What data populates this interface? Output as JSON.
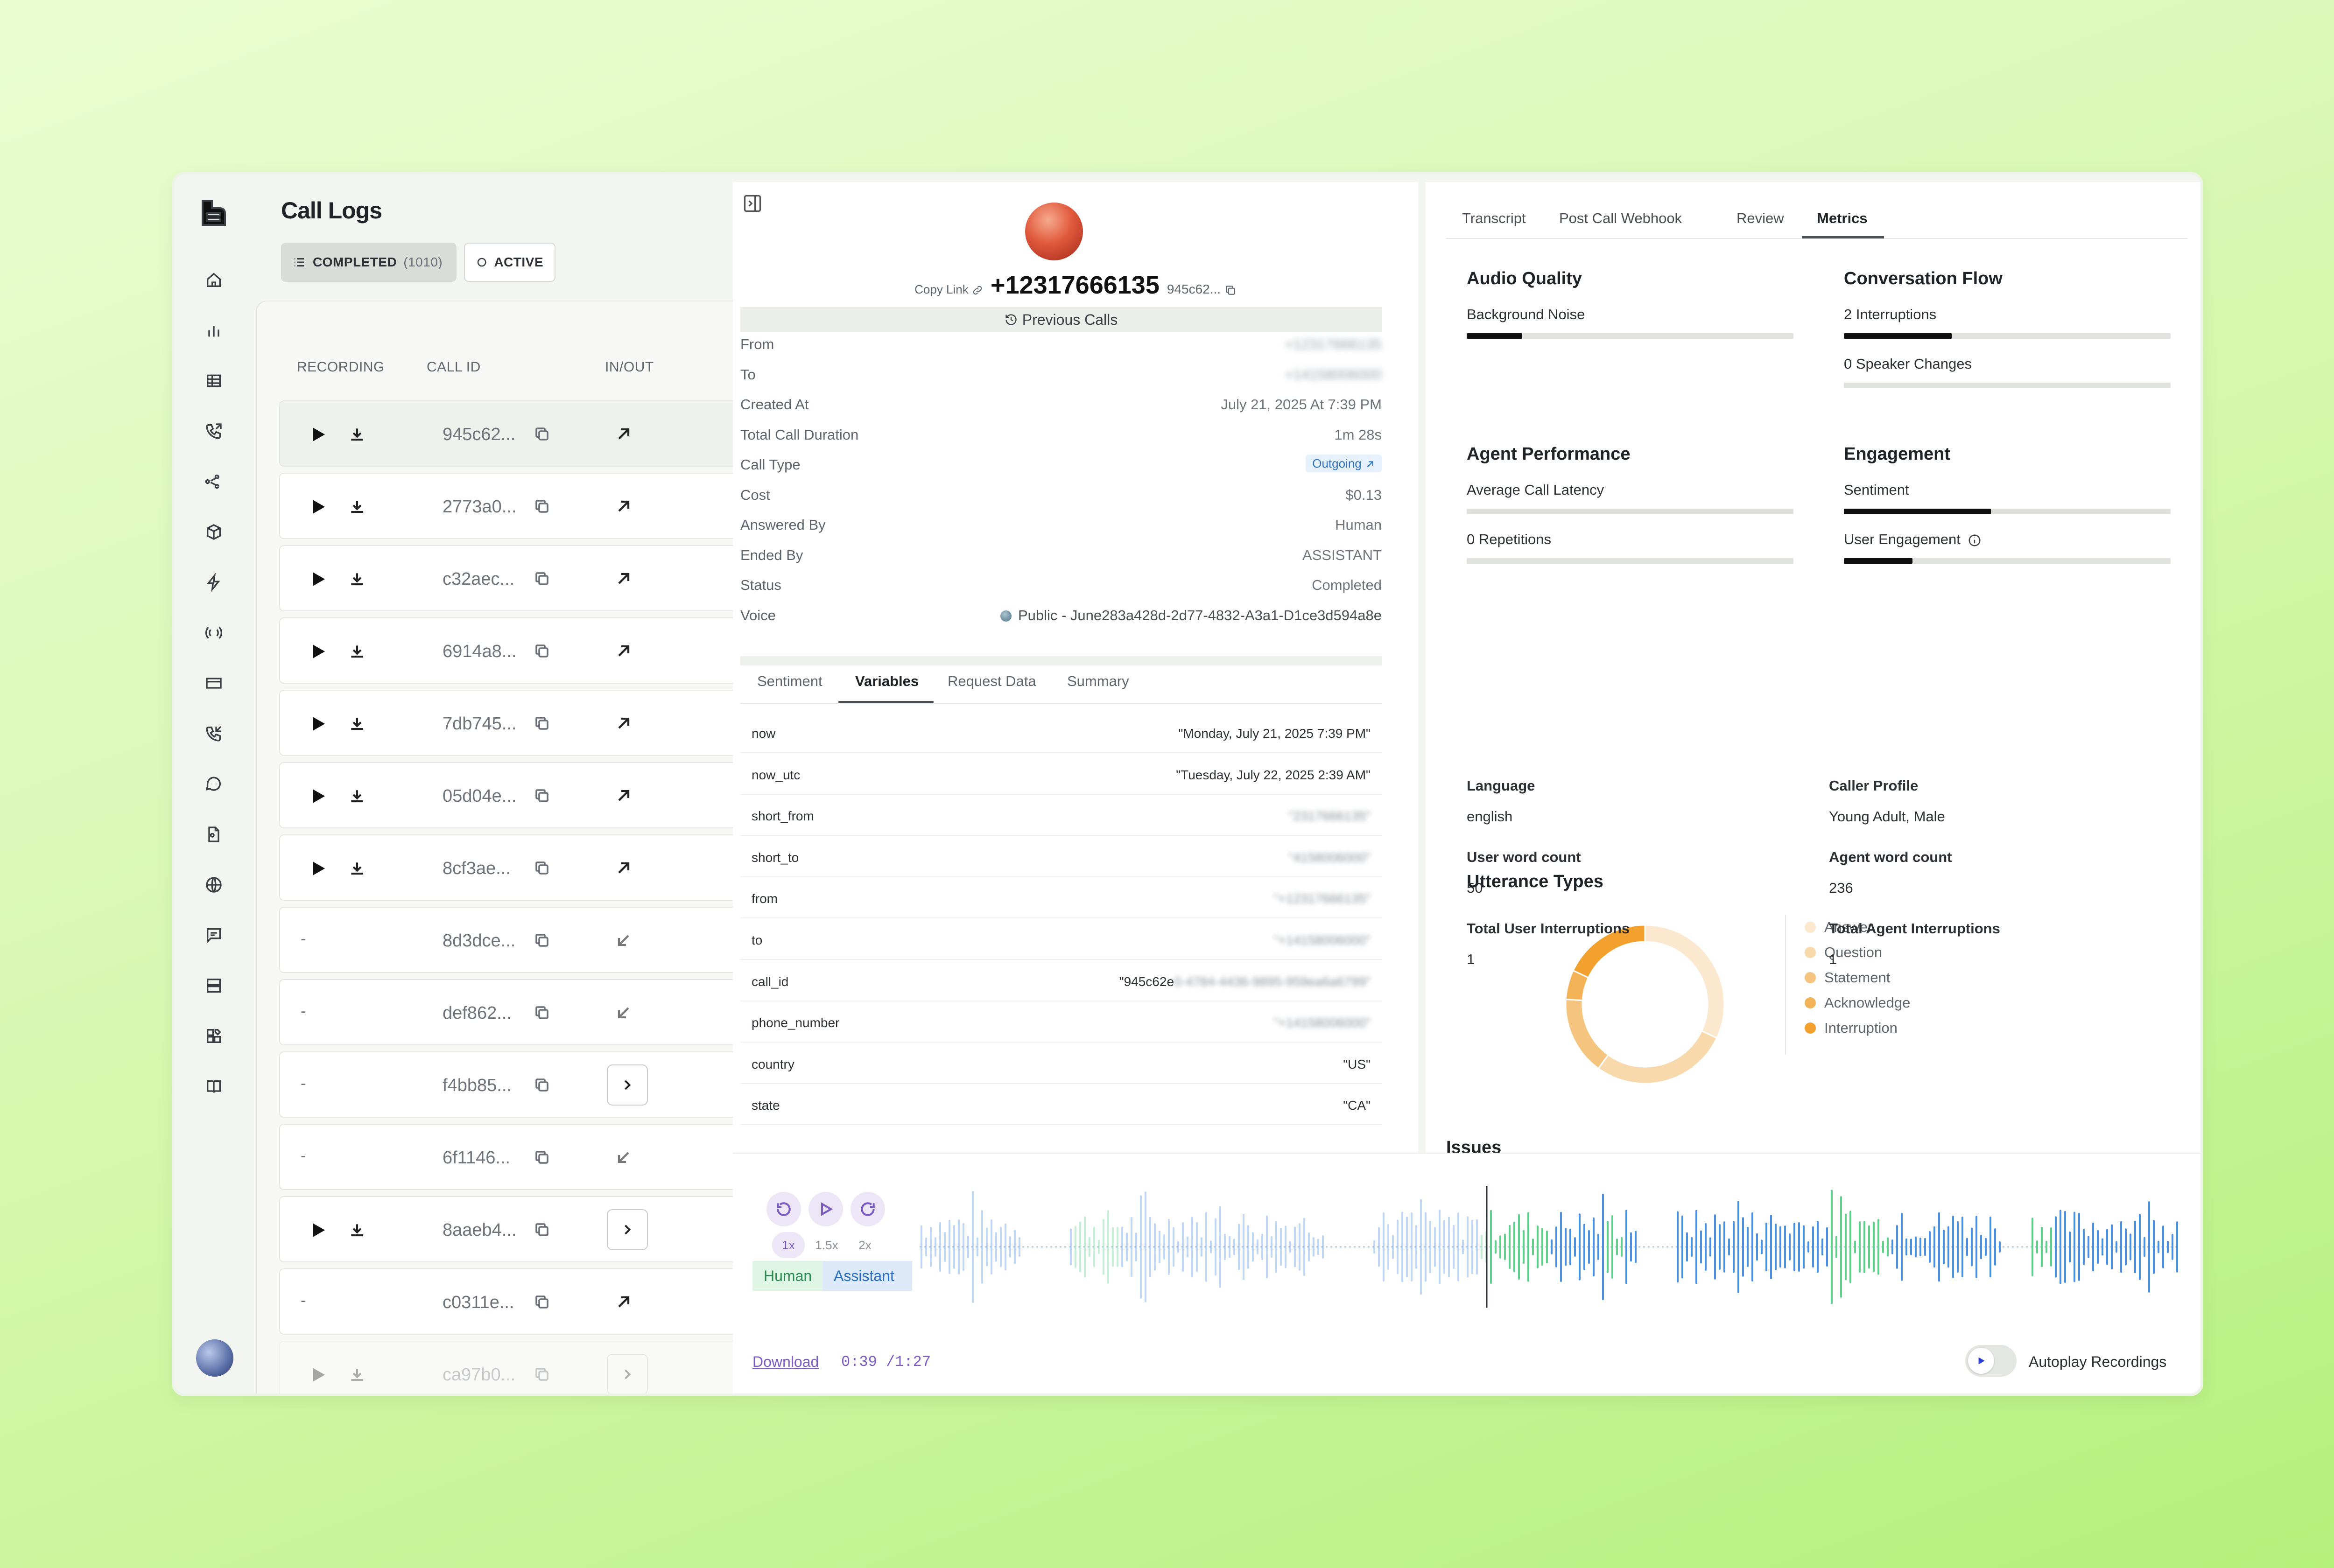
{
  "sidebar": {
    "icons": [
      "home-icon",
      "chart-icon",
      "table-icon",
      "phone-forward-icon",
      "share-icon",
      "box-icon",
      "bolt-icon",
      "broadcast-icon",
      "card-icon",
      "phone-incoming-icon",
      "chat-icon",
      "file-settings-icon",
      "globe-icon",
      "message-square-icon",
      "server-icon",
      "widgets-icon",
      "book-icon"
    ]
  },
  "call_logs": {
    "title": "Call Logs",
    "tab_completed": "COMPLETED",
    "tab_completed_count": "(1010)",
    "tab_active": "ACTIVE",
    "col_recording": "RECORDING",
    "col_call_id": "CALL ID",
    "col_inout": "IN/OUT",
    "rows": [
      {
        "id": "945c62...",
        "recording": true,
        "dir": "out"
      },
      {
        "id": "2773a0...",
        "recording": true,
        "dir": "out"
      },
      {
        "id": "c32aec...",
        "recording": true,
        "dir": "out"
      },
      {
        "id": "6914a8...",
        "recording": true,
        "dir": "out"
      },
      {
        "id": "7db745...",
        "recording": true,
        "dir": "out"
      },
      {
        "id": "05d04e...",
        "recording": true,
        "dir": "out"
      },
      {
        "id": "8cf3ae...",
        "recording": true,
        "dir": "out"
      },
      {
        "id": "8d3dce...",
        "recording": false,
        "dir": "in"
      },
      {
        "id": "def862...",
        "recording": false,
        "dir": "in"
      },
      {
        "id": "f4bb85...",
        "recording": false,
        "dir": "chevron"
      },
      {
        "id": "6f1146...",
        "recording": false,
        "dir": "in"
      },
      {
        "id": "8aaeb4...",
        "recording": true,
        "dir": "chevron"
      },
      {
        "id": "c0311e...",
        "recording": false,
        "dir": "out"
      },
      {
        "id": "ca97b0...",
        "recording": true,
        "dir": "chevron"
      }
    ],
    "dash": "-"
  },
  "details": {
    "copy_link": "Copy Link",
    "phone": "+12317666135",
    "short_id": "945c62...",
    "previous_calls": "Previous Calls",
    "fields": [
      {
        "key": "From",
        "value": "+12317666135",
        "blur": true
      },
      {
        "key": "To",
        "value": "+14158006000",
        "blur": true
      },
      {
        "key": "Created At",
        "value": "July 21, 2025 At 7:39 PM"
      },
      {
        "key": "Total Call Duration",
        "value": "1m 28s"
      },
      {
        "key": "Call Type",
        "value": "Outgoing"
      },
      {
        "key": "Cost",
        "value": "$0.13"
      },
      {
        "key": "Answered By",
        "value": "Human"
      },
      {
        "key": "Ended By",
        "value": "ASSISTANT"
      },
      {
        "key": "Status",
        "value": "Completed"
      },
      {
        "key": "Voice",
        "value": "Public - June283a428d-2d77-4832-A3a1-D1ce3d594a8e"
      }
    ],
    "tabs": [
      "Sentiment",
      "Variables",
      "Request Data",
      "Summary"
    ],
    "active_tab": "Variables",
    "variables": [
      {
        "key": "now",
        "value": "\"Monday, July 21, 2025 7:39 PM\""
      },
      {
        "key": "now_utc",
        "value": "\"Tuesday, July 22, 2025 2:39 AM\""
      },
      {
        "key": "short_from",
        "value": "\"2317666135\"",
        "blur": true
      },
      {
        "key": "short_to",
        "value": "\"4158006000\"",
        "blur": true
      },
      {
        "key": "from",
        "value": "\"+12317666135\"",
        "blur": true
      },
      {
        "key": "to",
        "value": "\"+14158006000\"",
        "blur": true
      },
      {
        "key": "call_id",
        "value": "\"945c62e",
        "value_blur": "0-4784-4436-9895-959ea6a6799\""
      },
      {
        "key": "phone_number",
        "value": "\"+14158006000\"",
        "blur": true
      },
      {
        "key": "country",
        "value": "\"US\""
      },
      {
        "key": "state",
        "value": "\"CA\""
      }
    ]
  },
  "metrics": {
    "tabs": [
      "Transcript",
      "Post Call Webhook",
      "Review",
      "Metrics"
    ],
    "active_tab": "Metrics",
    "audio_quality": {
      "title": "Audio Quality",
      "items": [
        {
          "label": "Background Noise",
          "value": 0.17
        }
      ]
    },
    "conversation_flow": {
      "title": "Conversation Flow",
      "items": [
        {
          "label": "2 Interruptions",
          "value": 0.33
        },
        {
          "label": "0 Speaker Changes",
          "value": 0.0
        }
      ]
    },
    "agent_performance": {
      "title": "Agent Performance",
      "items": [
        {
          "label": "Average Call Latency",
          "value": 0.0
        },
        {
          "label": "0 Repetitions",
          "value": 0.0
        }
      ]
    },
    "engagement": {
      "title": "Engagement",
      "items": [
        {
          "label": "Sentiment",
          "value": 0.45
        },
        {
          "label": "User Engagement",
          "value": 0.21
        }
      ]
    },
    "stats": [
      {
        "label": "Language",
        "value": "english"
      },
      {
        "label": "Caller Profile",
        "value": "Young Adult, Male"
      },
      {
        "label": "User word count",
        "value": "50"
      },
      {
        "label": "Agent word count",
        "value": "236"
      },
      {
        "label": "Total User Interruptions",
        "value": "1"
      },
      {
        "label": "Total Agent Interruptions",
        "value": "1"
      }
    ],
    "utterance_title": "Utterance Types",
    "utterance": [
      {
        "name": "Answer",
        "value": 0.32,
        "color": "#fbe8cf"
      },
      {
        "name": "Question",
        "value": 0.28,
        "color": "#f8d9ac"
      },
      {
        "name": "Statement",
        "value": 0.16,
        "color": "#f5c57f"
      },
      {
        "name": "Acknowledge",
        "value": 0.06,
        "color": "#f3b256"
      },
      {
        "name": "Interruption",
        "value": 0.18,
        "color": "#f2a12e"
      }
    ],
    "issues_title": "Issues"
  },
  "player": {
    "speeds": [
      "1x",
      "1.5x",
      "2x"
    ],
    "active_speed": "1x",
    "human": "Human",
    "assistant": "Assistant",
    "download": "Download",
    "time": "0:39 /1:27",
    "progress": 0.45,
    "autoplay": "Autoplay Recordings",
    "colors": {
      "human": "#5fd08c",
      "assistant": "#4a90e2"
    }
  }
}
